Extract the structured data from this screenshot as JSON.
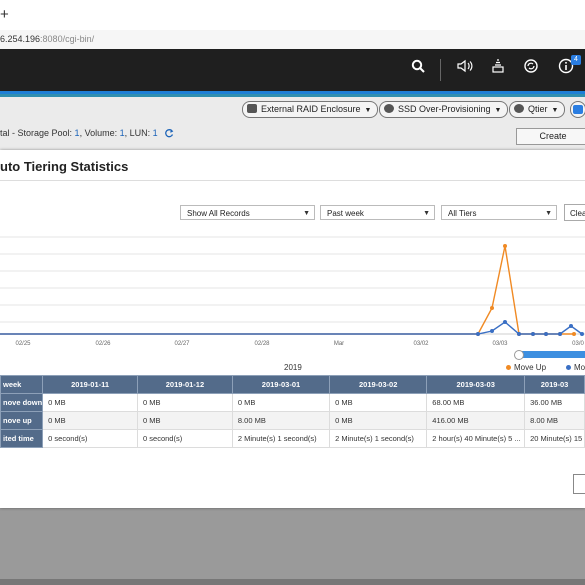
{
  "browser": {
    "new_tab": "+",
    "url_main": "6.254.196",
    "url_rest": ":8080/cgi-bin/"
  },
  "topbar": {
    "icons": [
      "search-icon",
      "volume-icon",
      "tasks-icon",
      "sync-icon",
      "info-icon"
    ],
    "notification_count": "4"
  },
  "toolbar": {
    "external_raid": "External RAID Enclosure",
    "ssd_overprov": "SSD Over-Provisioning",
    "qtier": "Qtier"
  },
  "breadcrumb": {
    "prefix": "tal - Storage Pool: ",
    "pool": "1",
    "vol_label": ", Volume: ",
    "vol": "1",
    "lun_label": ", LUN: ",
    "lun": "1"
  },
  "create_label": "Create",
  "dialog": {
    "title": "uto Tiering Statistics",
    "filters": {
      "records": "Show All Records",
      "period": "Past week",
      "tiers": "All Tiers",
      "clear": "Clea"
    },
    "year": "2019",
    "legend": {
      "move_up": "Move Up",
      "move_down": "Mov"
    }
  },
  "chart_data": {
    "type": "line",
    "x_ticks": [
      "02/25",
      "02/26",
      "02/27",
      "02/28",
      "Mar",
      "03/02",
      "03/03",
      "03/0"
    ],
    "series": [
      {
        "name": "Move Up",
        "color": "#f08a24",
        "points": [
          [
            0,
            0
          ],
          [
            478,
            0
          ],
          [
            492,
            26
          ],
          [
            505,
            88
          ],
          [
            519,
            0
          ],
          [
            533,
            0
          ],
          [
            546,
            0
          ],
          [
            560,
            0
          ],
          [
            574,
            0
          ]
        ]
      },
      {
        "name": "Move Down",
        "color": "#3a6fc4",
        "points": [
          [
            0,
            0
          ],
          [
            478,
            0
          ],
          [
            492,
            3
          ],
          [
            505,
            12
          ],
          [
            519,
            0
          ],
          [
            533,
            0
          ],
          [
            546,
            0
          ],
          [
            560,
            0
          ],
          [
            571,
            8
          ],
          [
            582,
            0
          ]
        ]
      }
    ],
    "grid": true
  },
  "table": {
    "headers": [
      "week",
      "2019-01-11",
      "2019-01-12",
      "2019-03-01",
      "2019-03-02",
      "2019-03-03",
      "2019-03"
    ],
    "rows": [
      {
        "label": "nove down",
        "cells": [
          "0 MB",
          "0 MB",
          "0 MB",
          "0 MB",
          "68.00 MB",
          "36.00 MB"
        ]
      },
      {
        "label": "nove up",
        "cells": [
          "0 MB",
          "0 MB",
          "8.00 MB",
          "0 MB",
          "416.00 MB",
          "8.00 MB"
        ]
      },
      {
        "label": "ited time",
        "cells": [
          "0 second(s)",
          "0 second(s)",
          "2 Minute(s) 1 second(s)",
          "2 Minute(s) 1 second(s)",
          "2 hour(s) 40 Minute(s) 5 ...",
          "20 Minute(s) 15"
        ]
      }
    ]
  }
}
